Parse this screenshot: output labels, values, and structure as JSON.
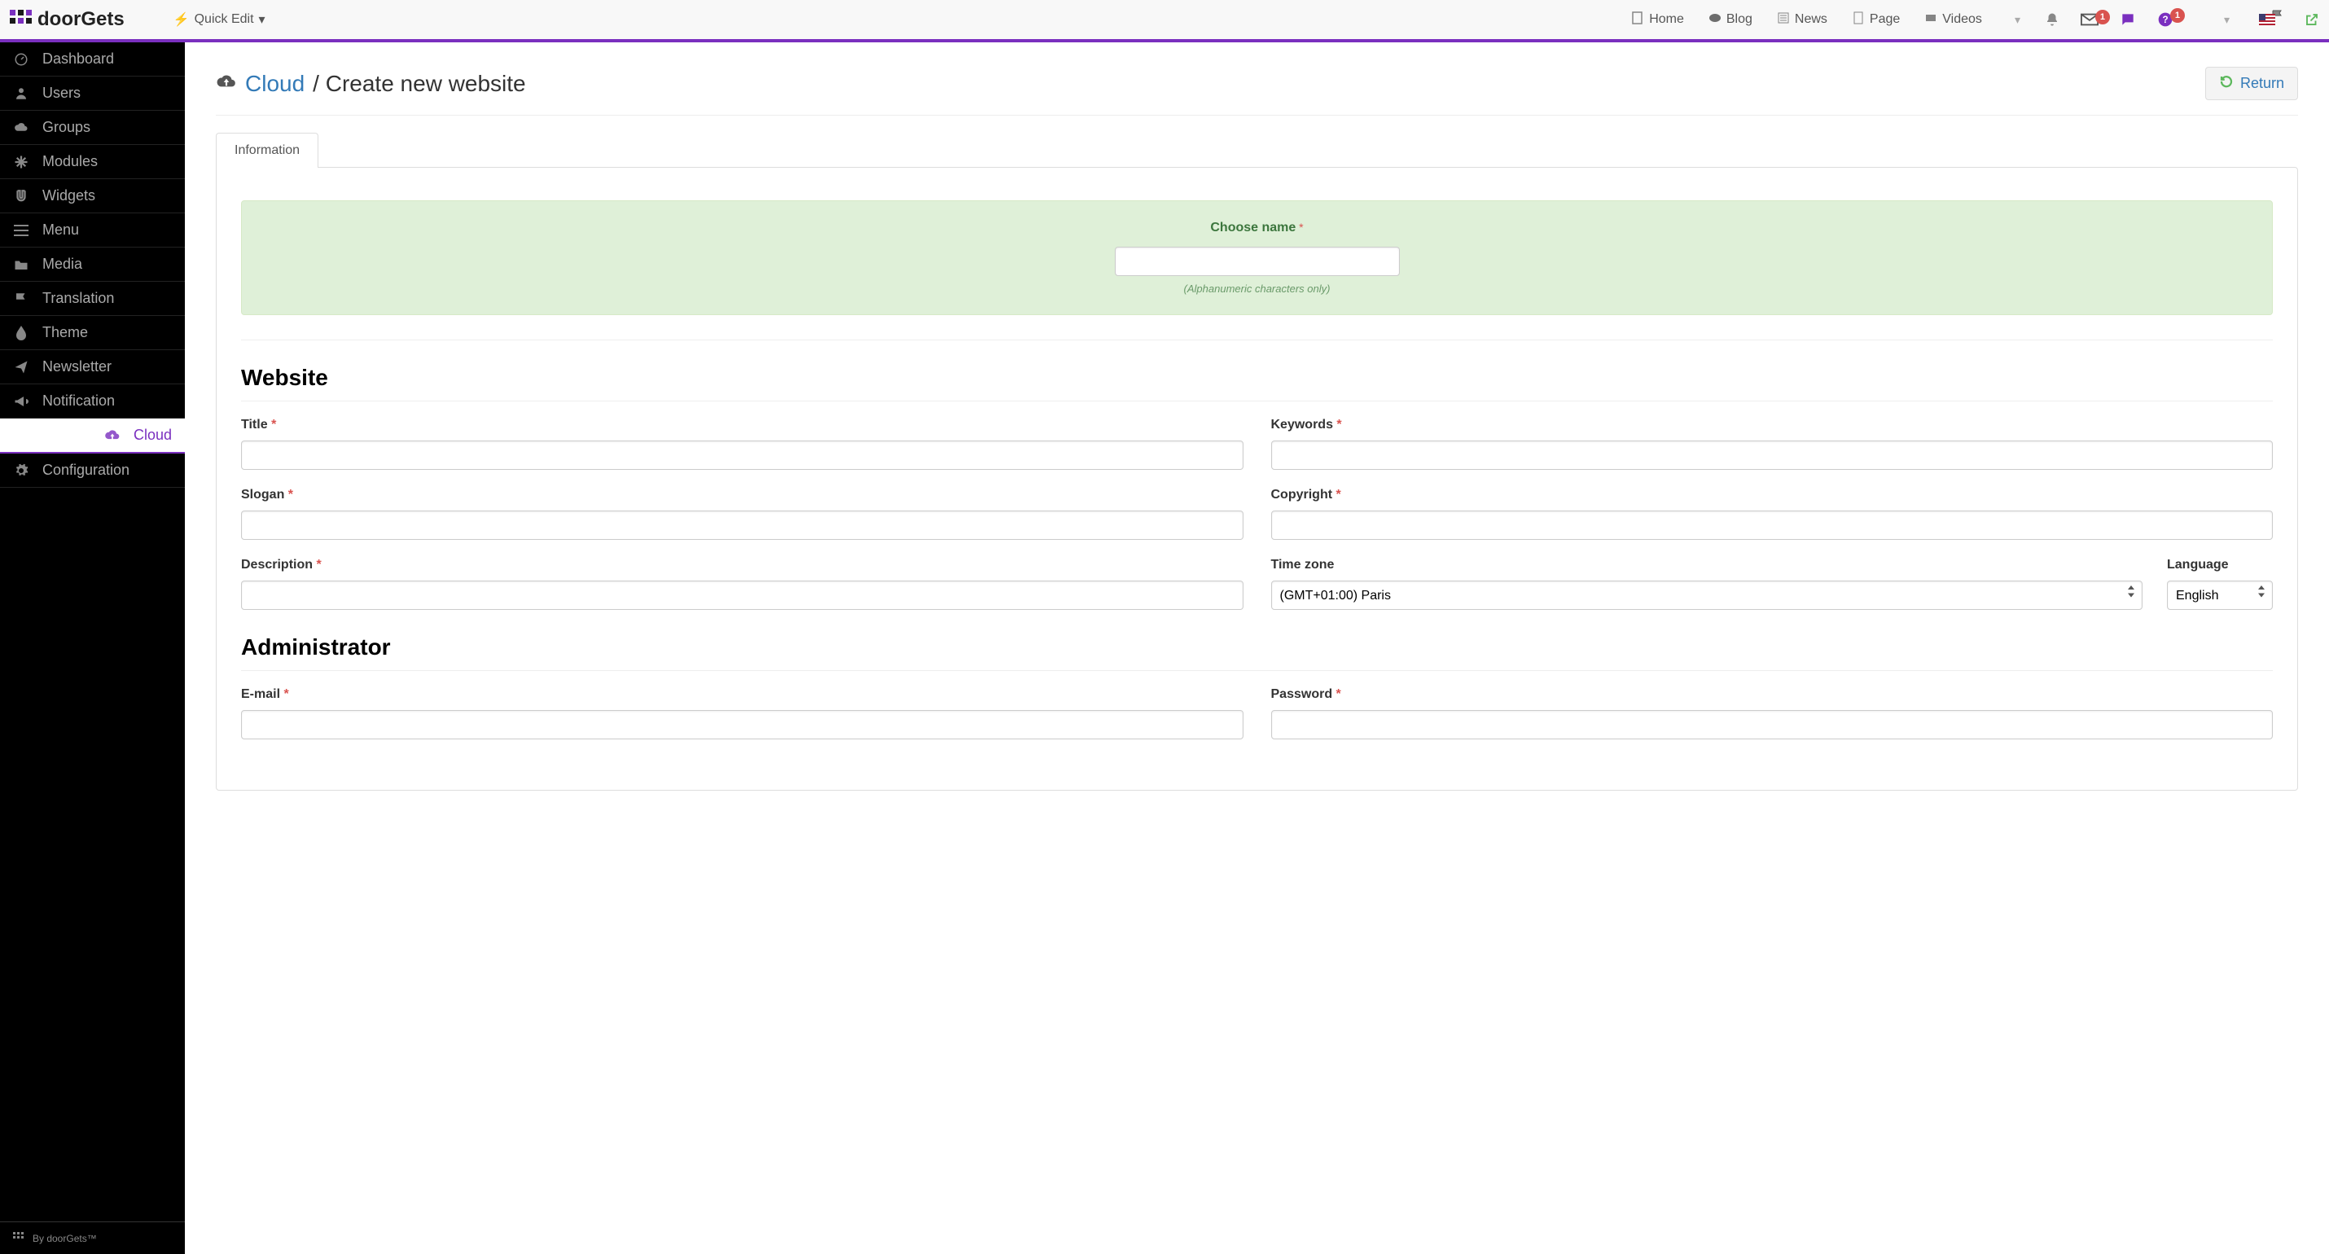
{
  "logo_text": "doorGets",
  "quick_edit": "Quick Edit",
  "nav": {
    "home": "Home",
    "blog": "Blog",
    "news": "News",
    "page": "Page",
    "videos": "Videos"
  },
  "badges": {
    "mail": "1",
    "help": "1"
  },
  "sidebar": {
    "items": [
      {
        "label": "Dashboard"
      },
      {
        "label": "Users"
      },
      {
        "label": "Groups"
      },
      {
        "label": "Modules"
      },
      {
        "label": "Widgets"
      },
      {
        "label": "Menu"
      },
      {
        "label": "Media"
      },
      {
        "label": "Translation"
      },
      {
        "label": "Theme"
      },
      {
        "label": "Newsletter"
      },
      {
        "label": "Notification"
      },
      {
        "label": "Cloud"
      },
      {
        "label": "Configuration"
      }
    ],
    "footer": "By doorGets™"
  },
  "page": {
    "breadcrumb_link": "Cloud",
    "breadcrumb_tail": "/ Create new website",
    "return": "Return",
    "tab": "Information"
  },
  "choose": {
    "label": "Choose name",
    "hint": "(Alphanumeric characters only)"
  },
  "section_website": "Website",
  "section_admin": "Administrator",
  "fields": {
    "title": "Title",
    "keywords": "Keywords",
    "slogan": "Slogan",
    "copyright": "Copyright",
    "description": "Description",
    "timezone": "Time zone",
    "language": "Language",
    "email": "E-mail",
    "password": "Password",
    "timezone_value": "(GMT+01:00) Paris",
    "language_value": "English"
  }
}
